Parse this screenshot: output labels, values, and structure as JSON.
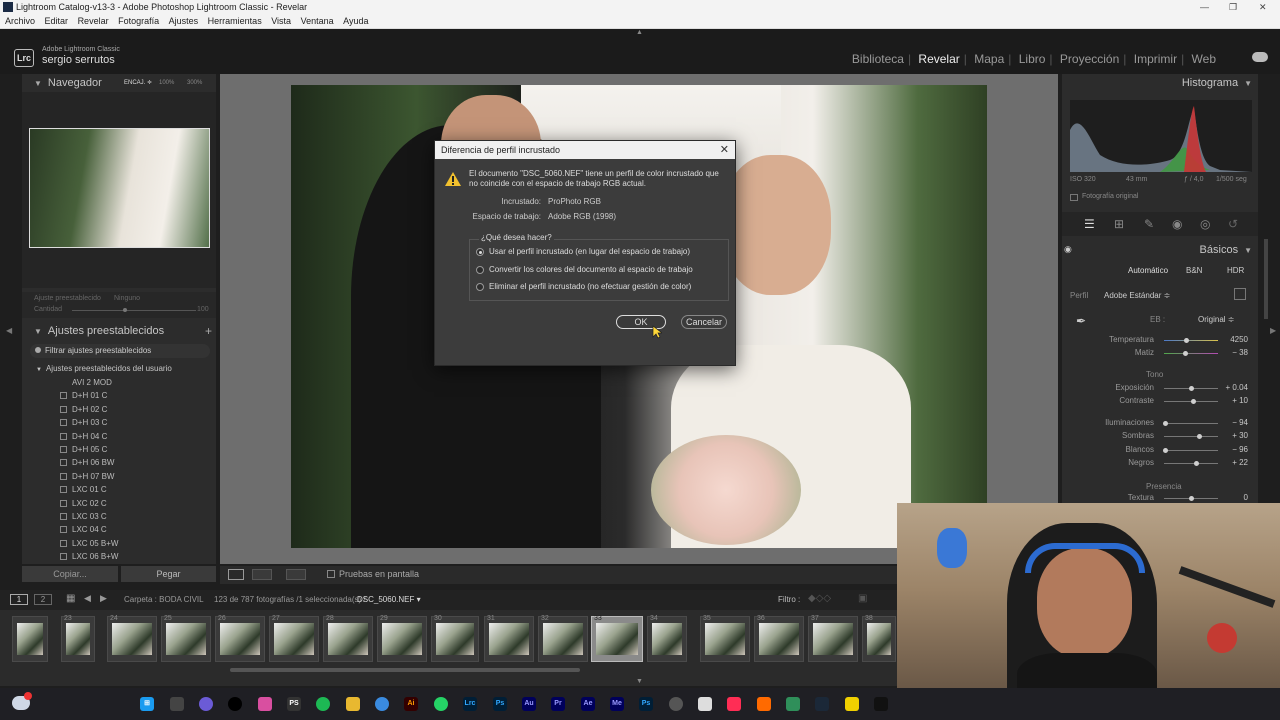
{
  "window": {
    "title": "Lightroom Catalog-v13-3 - Adobe Photoshop Lightroom Classic - Revelar"
  },
  "menu": [
    "Archivo",
    "Editar",
    "Revelar",
    "Fotografía",
    "Ajustes",
    "Herramientas",
    "Vista",
    "Ventana",
    "Ayuda"
  ],
  "identity": {
    "badge": "Lrc",
    "app_name": "Adobe Lightroom Classic",
    "user": "sergio serrutos"
  },
  "modules": [
    "Biblioteca",
    "Revelar",
    "Mapa",
    "Libro",
    "Proyección",
    "Imprimir",
    "Web"
  ],
  "left_panel": {
    "navigator": {
      "title": "Navegador",
      "zoom": [
        "ENCAJ. ≑",
        "100%",
        "300%"
      ]
    },
    "preset_amount": {
      "label": "Ajuste preestablecido",
      "value": "Ninguno",
      "amount_label": "Cantidad",
      "amount_value": "100"
    },
    "presets": {
      "title": "Ajustes preestablecidos",
      "add": "+",
      "filter": "Filtrar ajustes preestablecidos",
      "group": "Ajustes preestablecidos del usuario",
      "items": [
        "AVI 2 MOD",
        "D+H 01 C",
        "D+H 02 C",
        "D+H 03 C",
        "D+H 04 C",
        "D+H 05 C",
        "D+H 06 BW",
        "D+H 07 BW",
        "LXC 01 C",
        "LXC 02 C",
        "LXC 03 C",
        "LXC 04 C",
        "LXC 05 B+W",
        "LXC 06 B+W"
      ]
    },
    "copy_button": "Copiar...",
    "paste_button": "Pegar"
  },
  "toolbar": {
    "soft_proof": "Pruebas en pantalla"
  },
  "dialog": {
    "title": "Diferencia de perfil incrustado",
    "message_1": "El documento \"DSC_5060.NEF\" tiene un perfil de color incrustado que",
    "message_2": "no coincide con el espacio de trabajo RGB actual.",
    "embedded_label": "Incrustado:",
    "embedded_value": "ProPhoto RGB",
    "working_label": "Espacio de trabajo:",
    "working_value": "Adobe RGB (1998)",
    "question": "¿Qué desea hacer?",
    "options": [
      "Usar el perfil incrustado (en lugar del espacio de trabajo)",
      "Convertir los colores del documento al espacio de trabajo",
      "Eliminar el perfil incrustado (no efectuar gestión de color)"
    ],
    "ok": "OK",
    "cancel": "Cancelar"
  },
  "right_panel": {
    "histogram": {
      "title": "Histograma",
      "iso": "ISO 320",
      "focal": "43 mm",
      "aperture": "ƒ / 4,0",
      "shutter": "1/500 seg",
      "original": "Fotografía original"
    },
    "basic": {
      "title": "Básicos",
      "treatment": [
        "Automático",
        "B&N",
        "HDR"
      ],
      "profile_label": "Perfil",
      "profile_value": "Adobe Estándar ≑",
      "wb_label": "EB :",
      "wb_value": "Original ≑",
      "tone_label": "Tono",
      "presence_label": "Presencia",
      "sliders": [
        {
          "label": "Temperatura",
          "value": "4250",
          "pos": 0.42
        },
        {
          "label": "Matiz",
          "value": "− 38",
          "pos": 0.4
        },
        {
          "label": "Exposición",
          "value": "+ 0.04",
          "pos": 0.51
        },
        {
          "label": "Contraste",
          "value": "+ 10",
          "pos": 0.55
        },
        {
          "label": "Iluminaciones",
          "value": "− 94",
          "pos": 0.03
        },
        {
          "label": "Sombras",
          "value": "+ 30",
          "pos": 0.65
        },
        {
          "label": "Blancos",
          "value": "− 96",
          "pos": 0.02
        },
        {
          "label": "Negros",
          "value": "+ 22",
          "pos": 0.61
        },
        {
          "label": "Textura",
          "value": "0",
          "pos": 0.5
        }
      ]
    }
  },
  "filmstrip": {
    "views": [
      "1",
      "2"
    ],
    "folder": "Carpeta : BODA CIVIL",
    "count": "123 de 787 fotografías /1 seleccionada(s) /",
    "file": "DSC_5060.NEF ▾",
    "filter_label": "Filtro :",
    "numbers": [
      "23",
      "24",
      "25",
      "26",
      "27",
      "28",
      "29",
      "30",
      "31",
      "32",
      "33",
      "34",
      "35",
      "36",
      "37",
      "38"
    ]
  },
  "taskbar": {
    "icons": [
      "PS",
      "Lrc",
      "Ps",
      "Au",
      "Pr",
      "Ae",
      "Me",
      "Ai"
    ]
  }
}
